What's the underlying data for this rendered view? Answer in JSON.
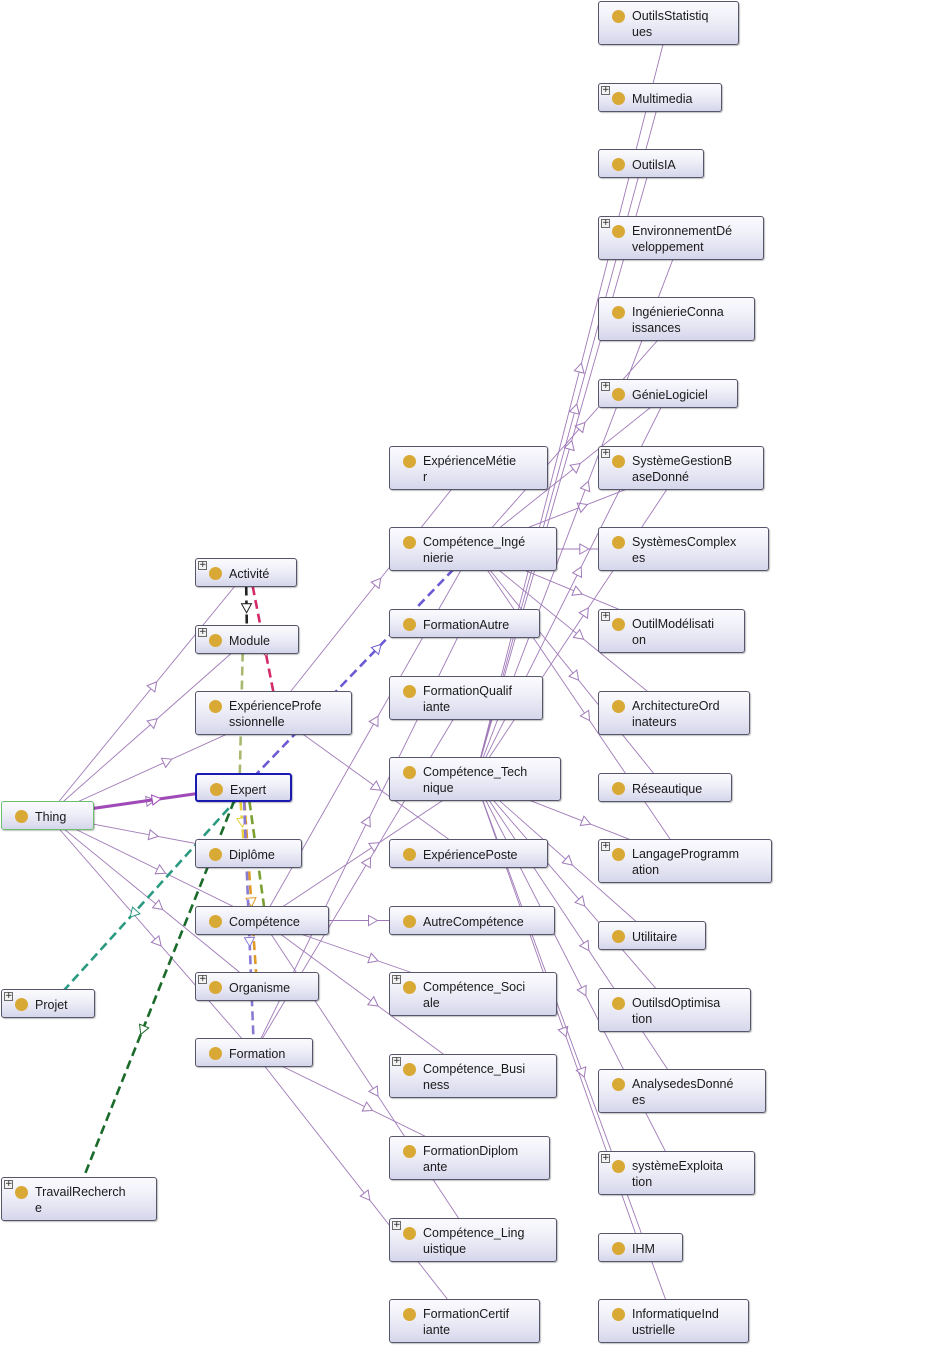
{
  "diagram": {
    "title": "Ontology class graph",
    "focused_node": "Expert",
    "colors": {
      "node_dot": "#d9a935",
      "subclass_edge": "#a07ab8",
      "focus_border": "#1a1ab0",
      "root_border": "#6ac06a"
    },
    "nodes": [
      {
        "id": "Thing",
        "label": "Thing",
        "expandable": false
      },
      {
        "id": "Projet",
        "label": "Projet",
        "expandable": true
      },
      {
        "id": "TravailRecherche",
        "label": "TravailRecherch\ne",
        "expandable": true
      },
      {
        "id": "Activite",
        "label": "Activité",
        "expandable": true
      },
      {
        "id": "Module",
        "label": "Module",
        "expandable": true
      },
      {
        "id": "ExperienceProfessionnelle",
        "label": "ExpérienceProfe\nssionnelle",
        "expandable": false
      },
      {
        "id": "Expert",
        "label": "Expert",
        "expandable": false
      },
      {
        "id": "Diplome",
        "label": "Diplôme",
        "expandable": false
      },
      {
        "id": "Competence",
        "label": "Compétence",
        "expandable": false
      },
      {
        "id": "Organisme",
        "label": "Organisme",
        "expandable": true
      },
      {
        "id": "Formation",
        "label": "Formation",
        "expandable": false
      },
      {
        "id": "ExperienceMetier",
        "label": "ExpérienceMétie\nr",
        "expandable": false
      },
      {
        "id": "CompetenceIngenierie",
        "label": "Compétence_Ingé\nnierie",
        "expandable": false
      },
      {
        "id": "FormationAutre",
        "label": "FormationAutre",
        "expandable": false
      },
      {
        "id": "FormationQualifiante",
        "label": "FormationQualif\niante",
        "expandable": false
      },
      {
        "id": "CompetenceTechnique",
        "label": "Compétence_Tech\nnique",
        "expandable": false
      },
      {
        "id": "ExperiencePoste",
        "label": "ExpériencePoste",
        "expandable": false
      },
      {
        "id": "AutreCompetence",
        "label": "AutreCompétence",
        "expandable": false
      },
      {
        "id": "CompetenceSociale",
        "label": "Compétence_Soci\nale",
        "expandable": true
      },
      {
        "id": "CompetenceBusiness",
        "label": "Compétence_Busi\nness",
        "expandable": true
      },
      {
        "id": "FormationDiplomante",
        "label": "FormationDiplom\nante",
        "expandable": false
      },
      {
        "id": "CompetenceLinguistique",
        "label": "Compétence_Ling\nuistique",
        "expandable": true
      },
      {
        "id": "FormationCertifiante",
        "label": "FormationCertif\niante",
        "expandable": false
      },
      {
        "id": "OutilsStatistiques",
        "label": "OutilsStatistiq\nues",
        "expandable": false
      },
      {
        "id": "Multimedia",
        "label": "Multimedia",
        "expandable": true
      },
      {
        "id": "OutilsIA",
        "label": "OutilsIA",
        "expandable": false
      },
      {
        "id": "EnvironnementDeveloppement",
        "label": "EnvironnementDé\nveloppement",
        "expandable": true
      },
      {
        "id": "IngenierieConnaissances",
        "label": "IngénierieConna\nissances",
        "expandable": false
      },
      {
        "id": "GenieLogiciel",
        "label": "GénieLogiciel",
        "expandable": true
      },
      {
        "id": "SystemeGestionBaseDonne",
        "label": "SystèmeGestionB\naseDonné",
        "expandable": true
      },
      {
        "id": "SystemesComplexes",
        "label": "SystèmesComplex\nes",
        "expandable": false
      },
      {
        "id": "OutilModelisation",
        "label": "OutilModélisati\non",
        "expandable": true
      },
      {
        "id": "ArchitectureOrdinateurs",
        "label": "ArchitectureOrd\ninateurs",
        "expandable": false
      },
      {
        "id": "Reseautique",
        "label": "Réseautique",
        "expandable": false
      },
      {
        "id": "LangageProgrammation",
        "label": "LangageProgramm\nation",
        "expandable": true
      },
      {
        "id": "Utilitaire",
        "label": "Utilitaire",
        "expandable": false
      },
      {
        "id": "OutilsdOptimisation",
        "label": "OutilsdOptimisa\ntion",
        "expandable": false
      },
      {
        "id": "AnalysesdesDonnees",
        "label": "AnalysedesDonné\nes",
        "expandable": false
      },
      {
        "id": "systemeExploitation",
        "label": "systèmeExploita\ntion",
        "expandable": true
      },
      {
        "id": "IHM",
        "label": "IHM",
        "expandable": false
      },
      {
        "id": "InformatiqueIndustrielle",
        "label": "InformatiqueInd\nustrielle",
        "expandable": false
      }
    ],
    "subclass_edges": [
      [
        "Thing",
        "Activite"
      ],
      [
        "Thing",
        "Module"
      ],
      [
        "Thing",
        "ExperienceProfessionnelle"
      ],
      [
        "Thing",
        "Expert"
      ],
      [
        "Thing",
        "Diplome"
      ],
      [
        "Thing",
        "Competence"
      ],
      [
        "Thing",
        "Organisme"
      ],
      [
        "Thing",
        "Formation"
      ],
      [
        "ExperienceProfessionnelle",
        "ExperienceMetier"
      ],
      [
        "ExperienceProfessionnelle",
        "ExperiencePoste"
      ],
      [
        "Competence",
        "CompetenceIngenierie"
      ],
      [
        "Competence",
        "CompetenceTechnique"
      ],
      [
        "Competence",
        "AutreCompetence"
      ],
      [
        "Competence",
        "CompetenceSociale"
      ],
      [
        "Competence",
        "CompetenceBusiness"
      ],
      [
        "Competence",
        "CompetenceLinguistique"
      ],
      [
        "Formation",
        "FormationAutre"
      ],
      [
        "Formation",
        "FormationQualifiante"
      ],
      [
        "Formation",
        "FormationDiplomante"
      ],
      [
        "Formation",
        "FormationCertifiante"
      ],
      [
        "CompetenceIngenierie",
        "IngenierieConnaissances"
      ],
      [
        "CompetenceIngenierie",
        "GenieLogiciel"
      ],
      [
        "CompetenceIngenierie",
        "SystemeGestionBaseDonne"
      ],
      [
        "CompetenceIngenierie",
        "SystemesComplexes"
      ],
      [
        "CompetenceIngenierie",
        "OutilModelisation"
      ],
      [
        "CompetenceIngenierie",
        "ArchitectureOrdinateurs"
      ],
      [
        "CompetenceIngenierie",
        "Reseautique"
      ],
      [
        "CompetenceIngenierie",
        "LangageProgrammation"
      ],
      [
        "CompetenceTechnique",
        "OutilsStatistiques"
      ],
      [
        "CompetenceTechnique",
        "Multimedia"
      ],
      [
        "CompetenceTechnique",
        "OutilsIA"
      ],
      [
        "CompetenceTechnique",
        "EnvironnementDeveloppement"
      ],
      [
        "CompetenceTechnique",
        "Utilitaire"
      ],
      [
        "CompetenceTechnique",
        "OutilsdOptimisation"
      ],
      [
        "CompetenceTechnique",
        "AnalysesdesDonnees"
      ],
      [
        "CompetenceTechnique",
        "systemeExploitation"
      ],
      [
        "CompetenceTechnique",
        "IHM"
      ],
      [
        "CompetenceTechnique",
        "InformatiqueIndustrielle"
      ],
      [
        "CompetenceTechnique",
        "LangageProgrammation"
      ],
      [
        "CompetenceTechnique",
        "GenieLogiciel"
      ],
      [
        "CompetenceTechnique",
        "SystemeGestionBaseDonne"
      ]
    ],
    "property_edges": [
      {
        "from": "Thing",
        "to": "Expert",
        "color": "#a04ab8",
        "style": "solid"
      },
      {
        "from": "Activite",
        "to": "Module",
        "color": "#222222",
        "style": "dashed"
      },
      {
        "from": "Activite",
        "to": "ExperienceProfessionnelle",
        "color": "#d42a6a",
        "style": "dashed"
      },
      {
        "from": "Expert",
        "to": "Module",
        "color": "#a8b870",
        "style": "dashed"
      },
      {
        "from": "Expert",
        "to": "CompetenceIngenierie",
        "color": "#6a5ad4",
        "style": "dashed"
      },
      {
        "from": "Expert",
        "to": "Projet",
        "color": "#2a9a80",
        "style": "dashed"
      },
      {
        "from": "Expert",
        "to": "TravailRecherche",
        "color": "#1a6a2a",
        "style": "dashed"
      },
      {
        "from": "Expert",
        "to": "Organisme",
        "color": "#e09a2a",
        "style": "dashed"
      },
      {
        "from": "Expert",
        "to": "Competence",
        "color": "#7aa030",
        "style": "dashed"
      },
      {
        "from": "Expert",
        "to": "Diplome",
        "color": "#e8d040",
        "style": "dashed"
      },
      {
        "from": "Expert",
        "to": "Formation",
        "color": "#8a7ad4",
        "style": "dashed"
      }
    ]
  }
}
